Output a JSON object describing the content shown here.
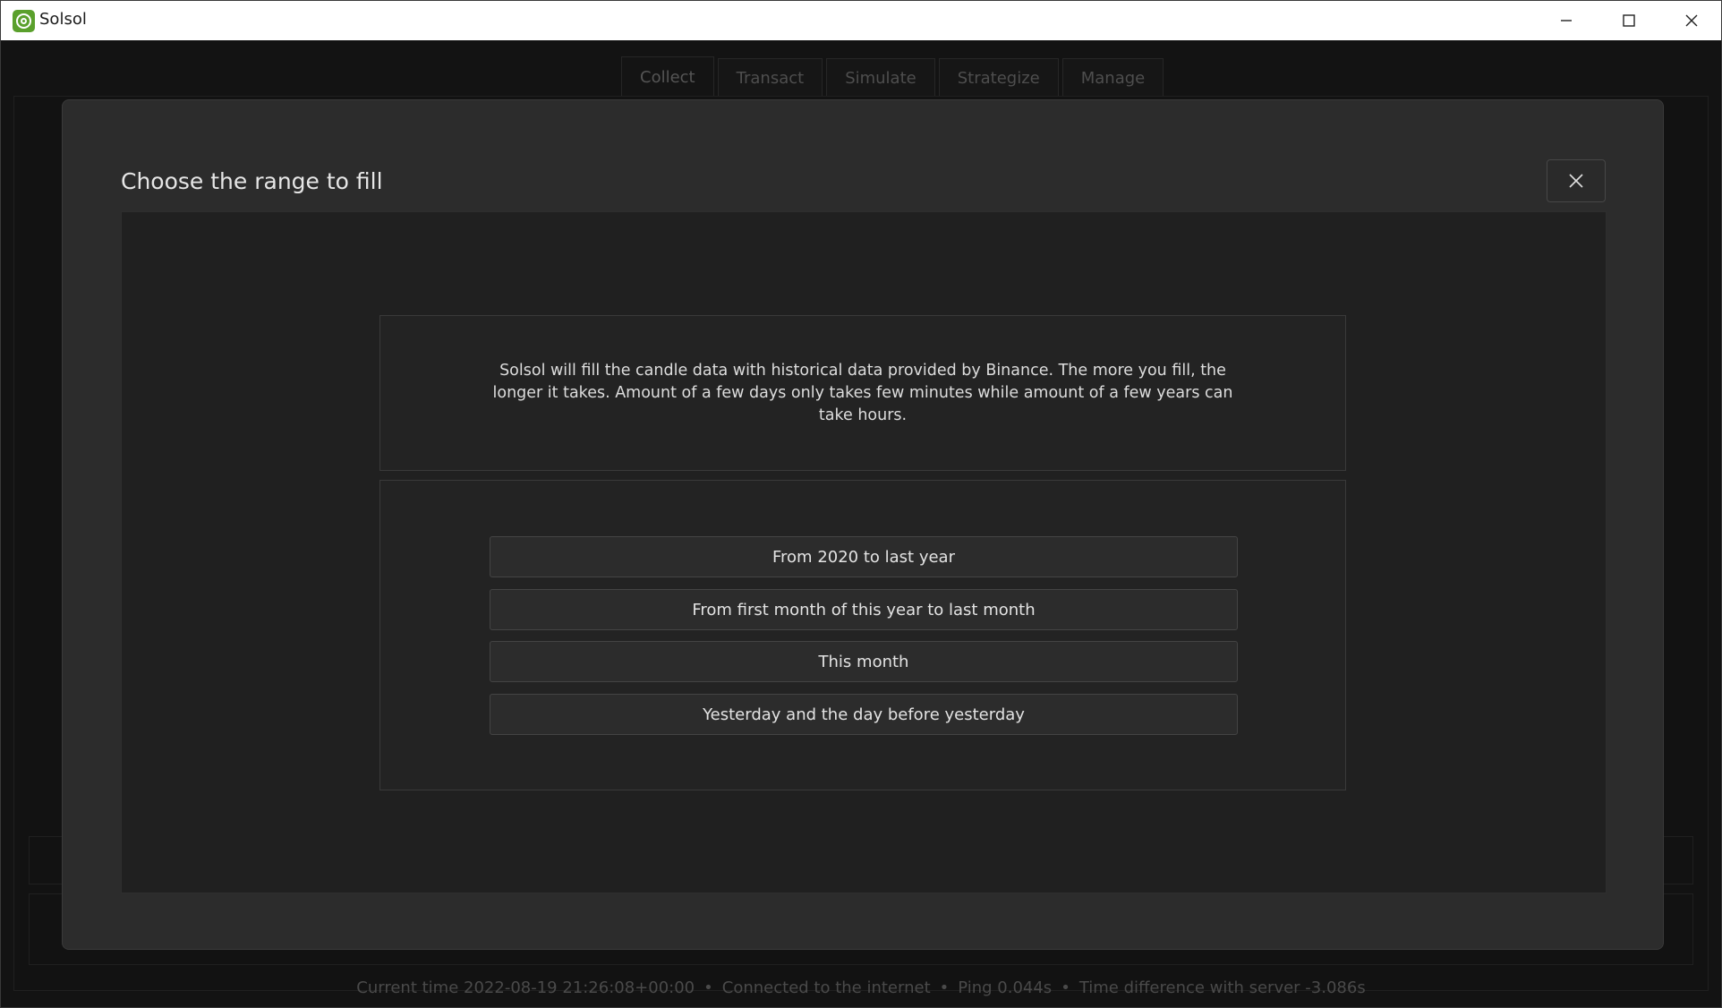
{
  "window": {
    "title": "Solsol",
    "icon": "solsol-logo-icon"
  },
  "tabs": [
    {
      "label": "Collect",
      "active": true
    },
    {
      "label": "Transact",
      "active": false
    },
    {
      "label": "Simulate",
      "active": false
    },
    {
      "label": "Strategize",
      "active": false
    },
    {
      "label": "Manage",
      "active": false
    }
  ],
  "status": {
    "current_time": "Current time 2022-08-19 21:26:08+00:00",
    "connection": "Connected to the internet",
    "ping": "Ping 0.044s",
    "time_difference": "Time difference with server -3.086s",
    "separator": "•"
  },
  "modal": {
    "title": "Choose the range to fill",
    "description": "Solsol will fill the candle data with historical data provided by Binance. The more you fill, the longer it takes. Amount of a few days only takes few minutes while amount of a few years can take hours.",
    "options": [
      "From 2020 to last year",
      "From first month of this year to last month",
      "This month",
      "Yesterday and the day before yesterday"
    ]
  },
  "colors": {
    "accent": "#5aa02c",
    "modal_bg": "#2c2c2c",
    "body_bg": "#202020"
  }
}
